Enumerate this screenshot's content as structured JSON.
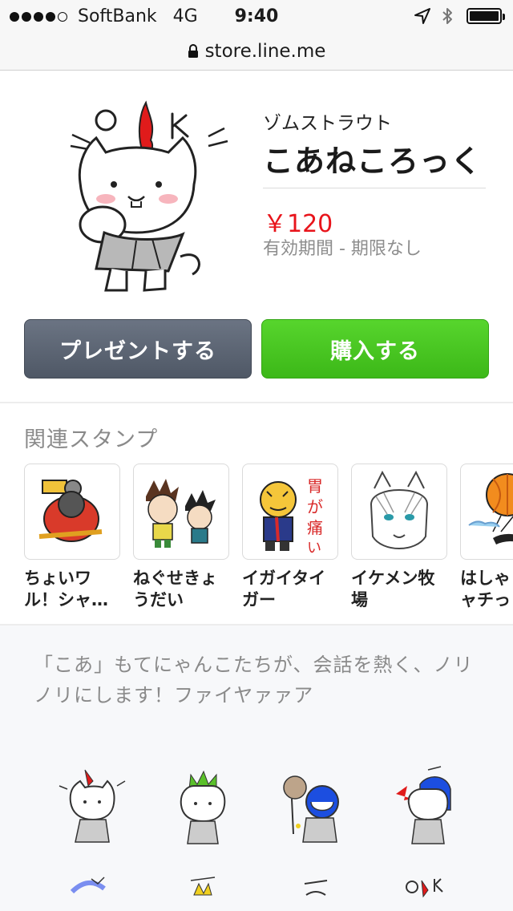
{
  "status_bar": {
    "carrier": "SoftBank",
    "network": "4G",
    "time": "9:40"
  },
  "browser": {
    "url": "store.line.me"
  },
  "product": {
    "author": "ゾムストラウト",
    "title": "こあねころっく",
    "price": "￥120",
    "validity": "有効期間 - 期限なし",
    "present_label": "プレゼントする",
    "buy_label": "購入する"
  },
  "related": {
    "title": "関連スタンプ",
    "items": [
      {
        "name": "ちょいワ\nル！シャ…"
      },
      {
        "name": "ねぐせきょ\nうだい"
      },
      {
        "name": "イガイタイ\nガー"
      },
      {
        "name": "イケメン牧\n場"
      },
      {
        "name": "はしゃ\nャチっ"
      }
    ]
  },
  "description": "「こあ」もてにゃんこたちが、会話を熱く、ノリノリにします！ファイヤァァア",
  "colors": {
    "price": "#e8141b",
    "buy_button": "#46c11e",
    "present_button": "#5e6674",
    "desc_background": "#f7f8fa"
  },
  "icons": {
    "location": "location-arrow-icon",
    "bluetooth": "bluetooth-icon",
    "battery": "battery-icon",
    "lock": "lock-icon"
  }
}
